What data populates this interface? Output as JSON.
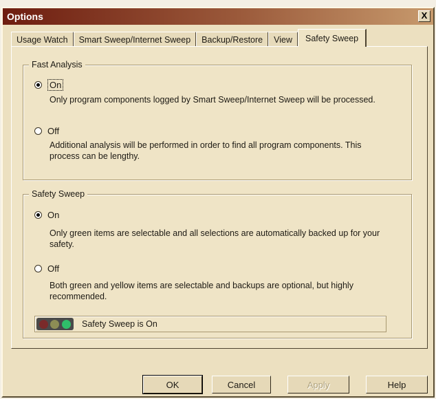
{
  "window": {
    "title": "Options",
    "close_label": "X"
  },
  "tabs": [
    {
      "label": "Usage Watch",
      "active": false
    },
    {
      "label": "Smart Sweep/Internet Sweep",
      "active": false
    },
    {
      "label": "Backup/Restore",
      "active": false
    },
    {
      "label": "View",
      "active": false
    },
    {
      "label": "Safety Sweep",
      "active": true
    }
  ],
  "fast_analysis": {
    "title": "Fast Analysis",
    "on_label": "On",
    "on_desc": "Only program components logged by Smart Sweep/Internet Sweep will be processed.",
    "off_label": "Off",
    "off_desc": "Additional analysis will be performed in order to find all program components.  This process can be lengthy.",
    "selected": "On"
  },
  "safety_sweep": {
    "title": "Safety Sweep",
    "on_label": "On",
    "on_desc": "Only green items are selectable and all selections are automatically backed up for your safety.",
    "off_label": "Off",
    "off_desc": "Both green and yellow items are selectable and backups are optional, but highly recommended.",
    "selected": "On",
    "status_text": "Safety Sweep is On",
    "lights": {
      "red": "#7a2a2a",
      "yellow": "#8d8d55",
      "green": "#2fbf6a"
    }
  },
  "buttons": {
    "ok": "OK",
    "cancel": "Cancel",
    "apply": "Apply",
    "help": "Help"
  }
}
